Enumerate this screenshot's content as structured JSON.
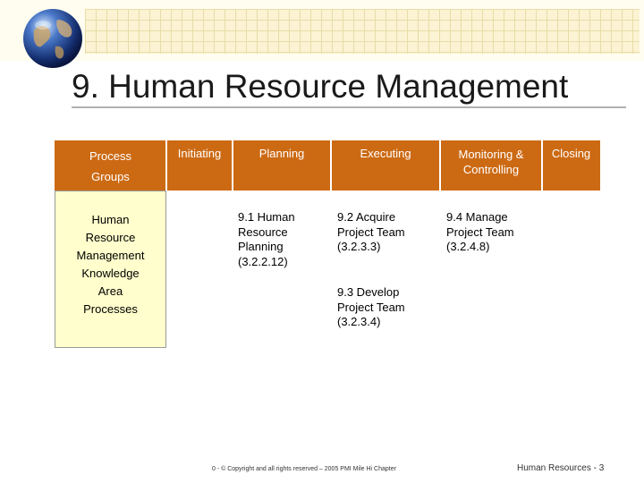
{
  "slide": {
    "title": "9. Human Resource Management"
  },
  "table": {
    "headers": {
      "process_groups_line1": "Process",
      "process_groups_line2": "Groups",
      "initiating": "Initiating",
      "planning": "Planning",
      "executing": "Executing",
      "monitoring_line1": "Monitoring &",
      "monitoring_line2": "Controlling",
      "closing": "Closing"
    },
    "row_label_lines": [
      "Human",
      "Resource",
      "Management",
      "Knowledge",
      "Area",
      "Processes"
    ],
    "planning_process_lines": [
      "9.1 Human",
      "Resource",
      "Planning",
      "(3.2.2.12)"
    ],
    "executing_process_1_lines": [
      "9.2 Acquire",
      "Project Team",
      "(3.2.3.3)"
    ],
    "executing_process_2_lines": [
      "9.3 Develop",
      "Project Team",
      "(3.2.3.4)"
    ],
    "monitoring_process_lines": [
      "9.4 Manage",
      "Project Team",
      "(3.2.4.8)"
    ]
  },
  "footer": {
    "copyright": "0 - © Copyright and all rights reserved – 2005 PMI Mile Hi Chapter",
    "page_label": "Human Resources - 3"
  },
  "colors": {
    "header_fill": "#cc6a14",
    "row_label_fill": "#fffecc"
  },
  "icons": [
    "globe-icon"
  ]
}
